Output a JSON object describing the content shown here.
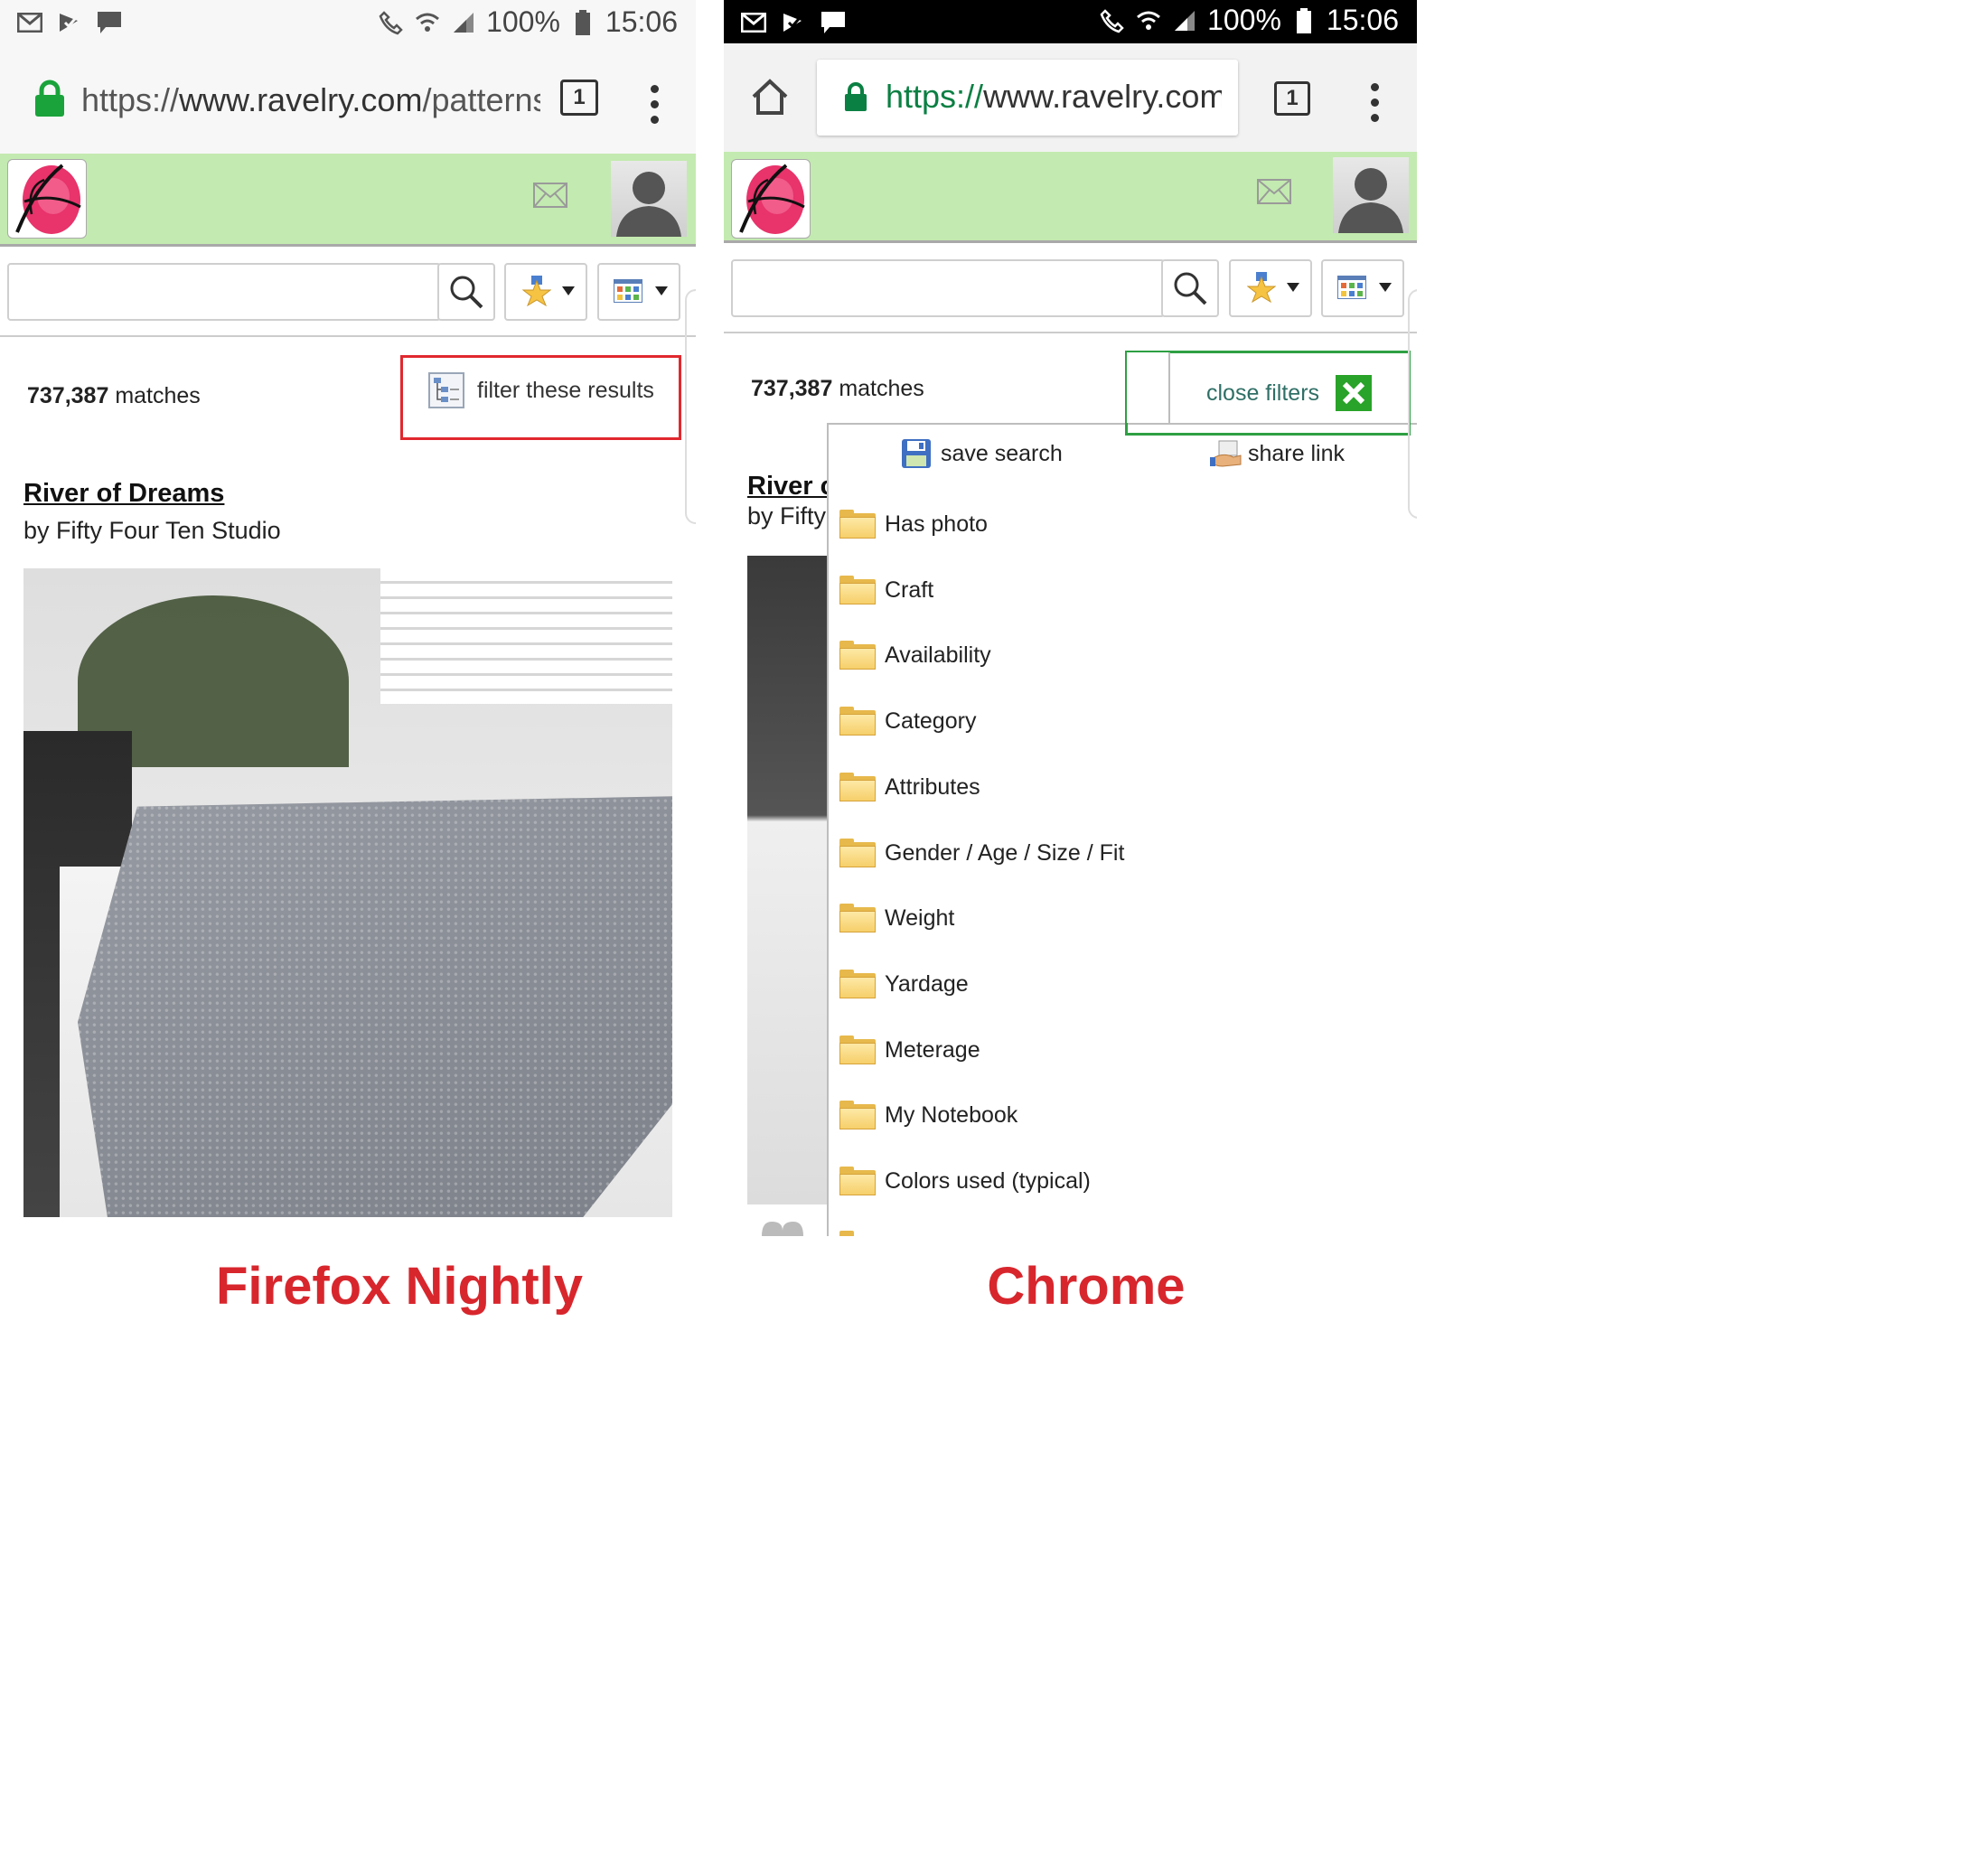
{
  "firefox": {
    "status": {
      "battery": "100%",
      "time": "15:06"
    },
    "address": {
      "url_prefix": "https://",
      "url_domain": "www.ravelry.com",
      "url_rest": "/patterns",
      "tab_count": "1"
    },
    "results": {
      "count": "737,387",
      "label": "matches"
    },
    "filter_button": "filter these results",
    "pattern": {
      "title": "River of Dreams",
      "byline": "by Fifty Four Ten Studio"
    },
    "caption": "Firefox Nightly",
    "highlight_color": "#e0282e"
  },
  "chrome": {
    "status": {
      "battery": "100%",
      "time": "15:06"
    },
    "address": {
      "url_prefix": "https://",
      "url_domain": "www.ravelry.com",
      "tab_count": "1"
    },
    "results": {
      "count": "737,387",
      "label": "matches"
    },
    "close_filters": "close filters",
    "save_search": "save search",
    "share_link": "share link",
    "filters": [
      "Has photo",
      "Craft",
      "Availability",
      "Category",
      "Attributes",
      "Gender / Age / Size / Fit",
      "Weight",
      "Yardage",
      "Meterage",
      "My Notebook",
      "Colors used (typical)"
    ],
    "pattern": {
      "title_partial": "River c",
      "byline_partial": "by Fifty"
    },
    "caption": "Chrome",
    "highlight_color": "#2ea043"
  },
  "colors": {
    "header_green": "#c3eab0",
    "lock_green": "#1aa33a",
    "caption_red": "#d8262d",
    "close_filters_text": "#2f6f66"
  }
}
